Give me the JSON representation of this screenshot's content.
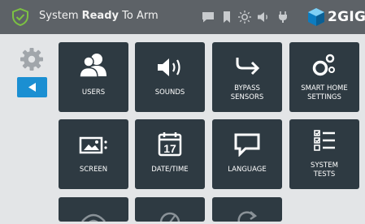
{
  "status": {
    "prefix": "System ",
    "bold": "Ready",
    "suffix": " To Arm"
  },
  "brand": {
    "name": "2GIG"
  },
  "tiles": {
    "users": "USERS",
    "sounds": "SOUNDS",
    "bypass_l1": "BYPASS",
    "bypass_l2": "SENSORS",
    "smarthome_l1": "SMART HOME",
    "smarthome_l2": "SETTINGS",
    "screen": "SCREEN",
    "datetime": "DATE/TIME",
    "calendar_day": "17",
    "language": "LANGUAGE",
    "systemtests_l1": "SYSTEM",
    "systemtests_l2": "TESTS"
  },
  "icons": [
    "shield-check-icon",
    "message-icon",
    "bookmark-icon",
    "brightness-icon",
    "volume-icon",
    "power-plug-icon",
    "2gig-logo",
    "gear-icon",
    "back-arrow-icon",
    "users-icon",
    "speaker-icon",
    "bypass-arrow-icon",
    "smart-home-icon",
    "screen-image-icon",
    "calendar-icon",
    "speech-bubble-icon",
    "checklist-icon"
  ],
  "colors": {
    "topbar": "#5d6267",
    "tile": "#2e3a42",
    "accent_blue": "#1b8fd2",
    "shield_green": "#7cc242",
    "background": "#e3e5e7"
  }
}
